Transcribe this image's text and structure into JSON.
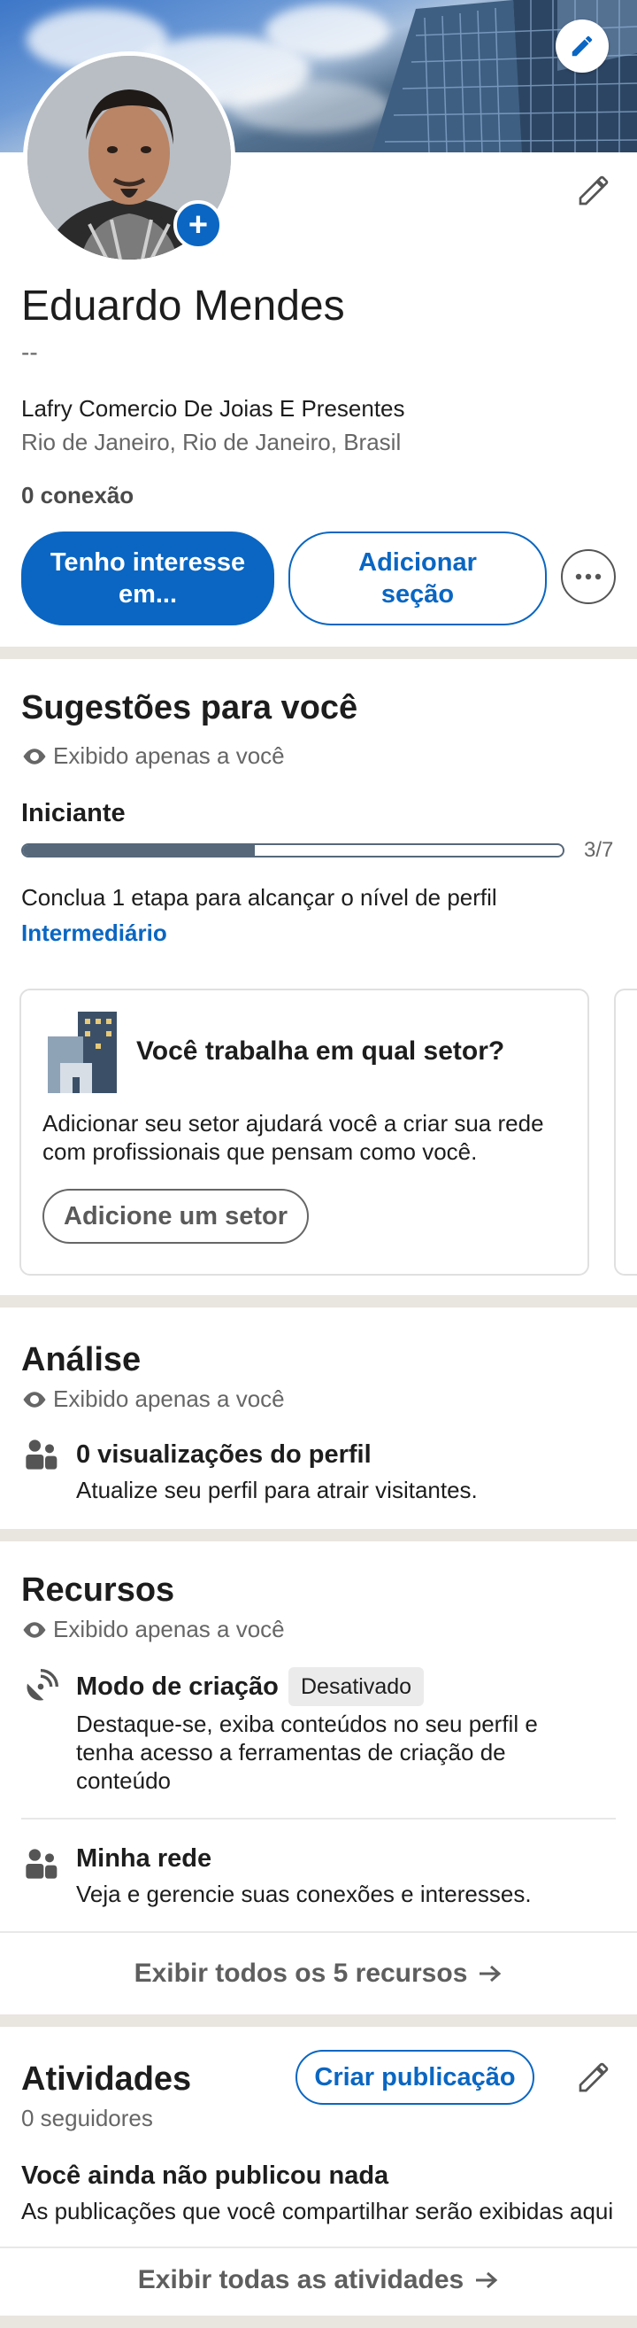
{
  "profile": {
    "name": "Eduardo Mendes",
    "headline": "--",
    "company": "Lafry Comercio De Joias E Presentes",
    "location": "Rio de Janeiro, Rio de Janeiro, Brasil",
    "connections": "0 conexão",
    "btn_interest": "Tenho interesse em...",
    "btn_add_section": "Adicionar seção"
  },
  "suggestions": {
    "title": "Sugestões para você",
    "private_note": "Exibido apenas a você",
    "level": "Iniciante",
    "progress_label": "3/7",
    "progress_value": 0.43,
    "next_step_text": "Conclua 1 etapa para alcançar o nível de perfil",
    "next_level": "Intermediário",
    "card": {
      "title": "Você trabalha em qual setor?",
      "text": "Adicionar seu setor ajudará você a criar sua rede com profissionais que pensam como você.",
      "button": "Adicione um setor"
    }
  },
  "analytics": {
    "title": "Análise",
    "private_note": "Exibido apenas a você",
    "item_title": "0 visualizações do perfil",
    "item_text": "Atualize seu perfil para atrair visitantes."
  },
  "resources": {
    "title": "Recursos",
    "private_note": "Exibido apenas a você",
    "creator_title": "Modo de criação",
    "creator_badge": "Desativado",
    "creator_text": "Destaque-se, exiba conteúdos no seu perfil e tenha acesso a ferramentas de criação de conteúdo",
    "network_title": "Minha rede",
    "network_text": "Veja e gerencie suas conexões e interesses.",
    "show_all": "Exibir todos os 5 recursos"
  },
  "activity": {
    "title": "Atividades",
    "followers": "0 seguidores",
    "create_post": "Criar publicação",
    "empty_title": "Você ainda não publicou nada",
    "empty_text": "As publicações que você compartilhar serão exibidas aqui",
    "show_all": "Exibir todas as atividades"
  },
  "icons": {
    "cover_edit": "pencil-icon",
    "profile_edit": "pencil-icon",
    "avatar_add": "plus-icon",
    "more": "more-horizontal-icon",
    "private": "eye-icon",
    "analytics": "people-icon",
    "creator": "satellite-dish-icon",
    "network": "people-icon",
    "arrow": "arrow-right-icon"
  },
  "colors": {
    "primary": "#0a66c2",
    "progress_fill": "#56687a",
    "section_band": "#e9e5df"
  }
}
